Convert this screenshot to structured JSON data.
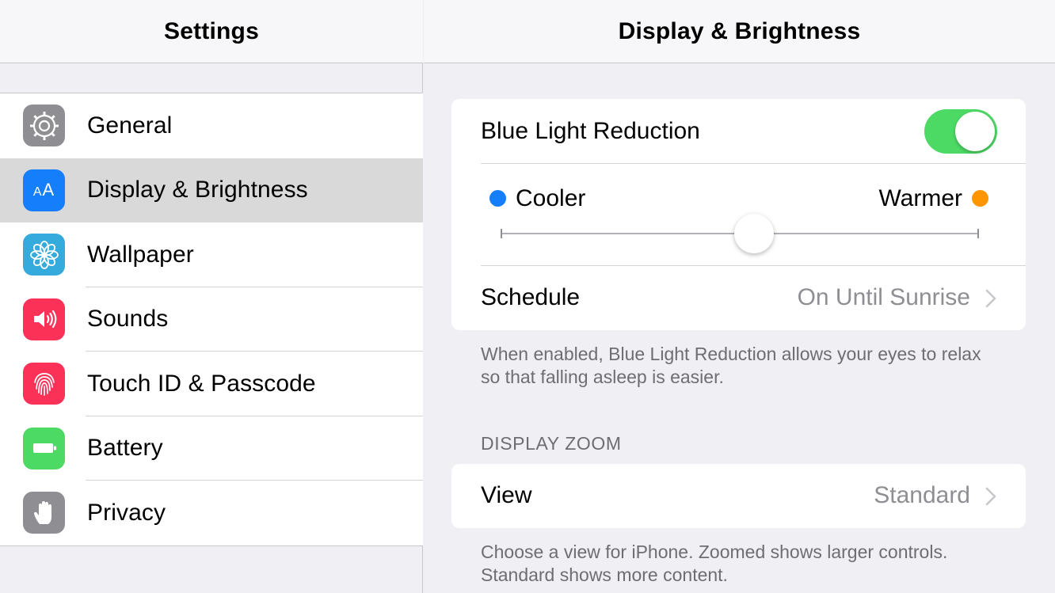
{
  "left": {
    "title": "Settings",
    "items": [
      {
        "label": "General",
        "color": "#8e8e93",
        "icon": "gear-icon"
      },
      {
        "label": "Display & Brightness",
        "color": "#147efb",
        "icon": "text-size-icon",
        "selected": true
      },
      {
        "label": "Wallpaper",
        "color": "#35aadc",
        "icon": "flower-icon"
      },
      {
        "label": "Sounds",
        "color": "#fc3158",
        "icon": "speaker-icon"
      },
      {
        "label": "Touch ID & Passcode",
        "color": "#fc3158",
        "icon": "fingerprint-icon"
      },
      {
        "label": "Battery",
        "color": "#4cd964",
        "icon": "battery-icon"
      },
      {
        "label": "Privacy",
        "color": "#8e8e93",
        "icon": "hand-icon"
      }
    ]
  },
  "right": {
    "title": "Display & Brightness",
    "blue_light": {
      "label": "Blue Light Reduction",
      "enabled": true,
      "cooler_label": "Cooler",
      "warmer_label": "Warmer",
      "cooler_color": "#147efb",
      "warmer_color": "#ff9500",
      "slider_value": 0.53
    },
    "schedule": {
      "label": "Schedule",
      "value": "On Until Sunrise"
    },
    "blue_light_footer": "When enabled, Blue Light Reduction allows your eyes to relax so that falling asleep is easier.",
    "zoom_header": "DISPLAY ZOOM",
    "view": {
      "label": "View",
      "value": "Standard"
    },
    "zoom_footer": "Choose a view for iPhone. Zoomed shows larger controls. Standard shows more content."
  },
  "colors": {
    "toggle_on": "#4cd964",
    "background": "#efeff4"
  }
}
